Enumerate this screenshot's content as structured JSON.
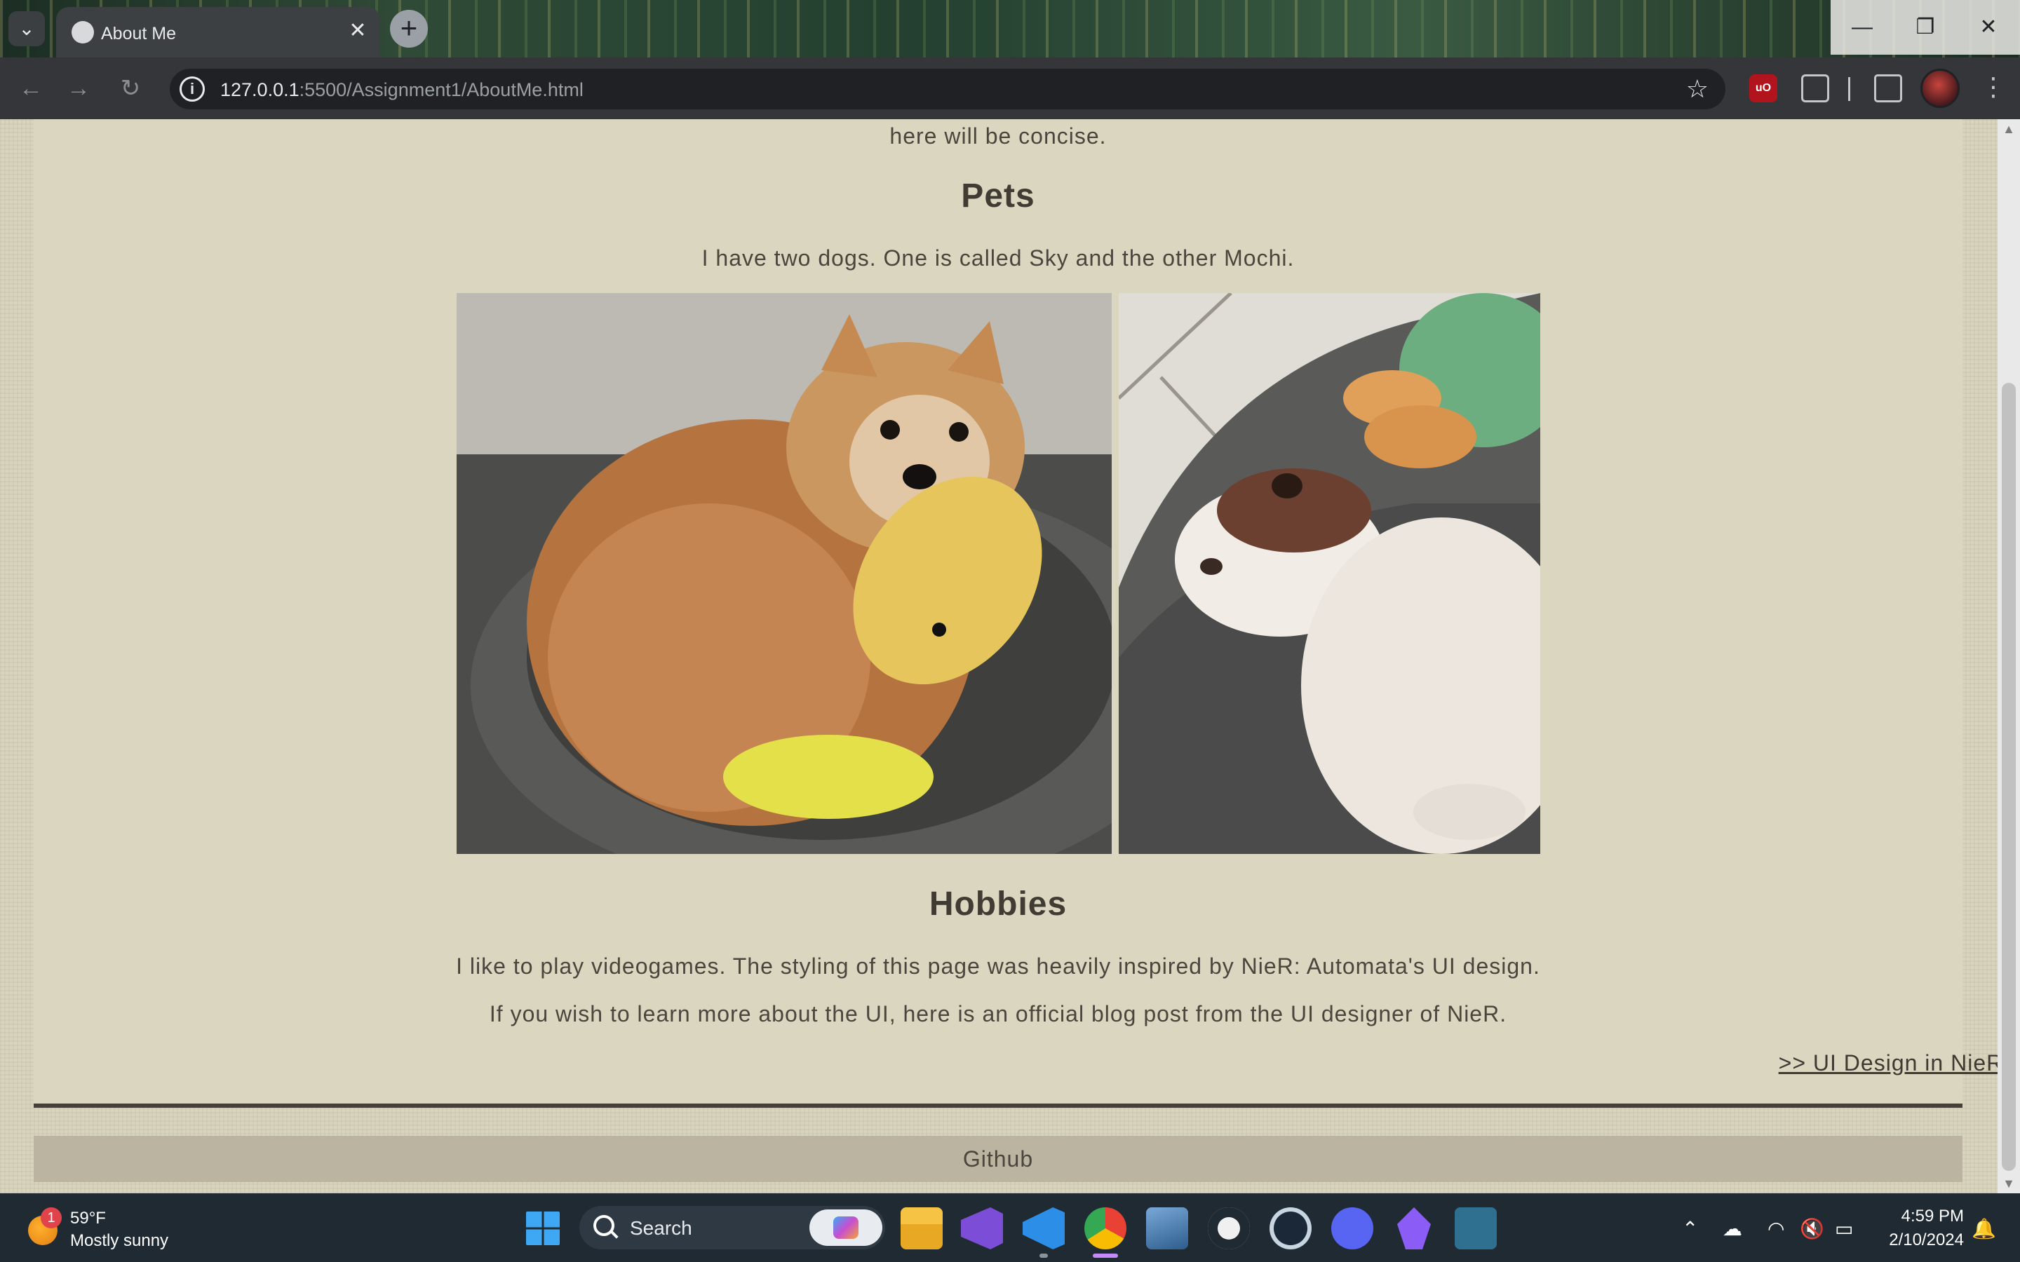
{
  "browser": {
    "tab_title": "About Me",
    "url_host": "127.0.0.1",
    "url_rest": ":5500/Assignment1/AboutMe.html",
    "new_tab_label": "+",
    "tab_close_label": "✕",
    "win_minimize": "—",
    "win_restore": "❐",
    "win_close": "✕"
  },
  "page": {
    "intro_tail": "here will be concise.",
    "pets_title": "Pets",
    "pets_text": "I have two dogs. One is called Sky and the other Mochi.",
    "hobbies_title": "Hobbies",
    "hobbies_text_1": "I like to play videogames. The styling of this page was heavily inspired by NieR: Automata's UI design.",
    "hobbies_text_2": "If you wish to learn more about the UI, here is an official blog post from the UI designer of NieR.",
    "hobbies_link": ">> UI Design in NieR:Automata <<",
    "footer_link": "Github"
  },
  "taskbar": {
    "weather_badge": "1",
    "temperature": "59°F",
    "condition": "Mostly sunny",
    "search_label": "Search",
    "time": "4:59 PM",
    "date": "2/10/2024",
    "apps": [
      "file-explorer",
      "visual-studio",
      "vscode",
      "chrome",
      "photo-viewer",
      "github-desktop",
      "steam",
      "discord",
      "obsidian",
      "mysql-workbench"
    ]
  },
  "colors": {
    "page_bg": "#dad6bf",
    "text": "#4a463e",
    "footer_bg": "#bab4a0",
    "rule": "#45413a"
  }
}
